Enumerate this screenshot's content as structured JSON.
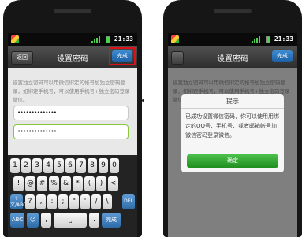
{
  "left_screen": {
    "status": {
      "time": "21:33"
    },
    "header": {
      "back_label": "返回",
      "title": "设置密码",
      "done_label": "完成"
    },
    "description": "设置独立密码可以用微信绑定的帐号加独立密码登录，如绑定手机号，可以使用手机号+独立密码登录微信。",
    "password_value": "••••••••••••••",
    "confirm_value": "••••••••••••••",
    "keyboard": {
      "row1": [
        "1",
        "2",
        "3",
        "4",
        "5",
        "6",
        "7",
        "8",
        "9",
        "0"
      ],
      "row2": [
        "!",
        "@",
        "#",
        "%",
        "&",
        "*",
        "(",
        ")",
        "<"
      ],
      "row3": [
        "?",
        ",",
        ":",
        ";",
        "\"",
        "'",
        "/",
        "\\"
      ],
      "fn_left": "⇧\n文/ABC",
      "del_label": "DEL",
      "abc_label": "ABC",
      "emoji": "☺",
      "comma": ",",
      "space": "⎵",
      "period": ".",
      "enter_label": "完成"
    }
  },
  "right_screen": {
    "status": {
      "time": "21:33"
    },
    "header": {
      "title": "设置密码",
      "done_label": "完成"
    },
    "dialog": {
      "title": "提示",
      "message": "已成功设置微信密码，你可以使用用绑定的QQ号、手机号、或者邮箱帐号加微信密码登录微信。",
      "ok_label": "确定"
    }
  },
  "colors": {
    "highlight": "#e0101a",
    "done_button": "#1d5ea4",
    "ok_button": "#1f8f1f",
    "focus_border": "#8cc63f"
  }
}
